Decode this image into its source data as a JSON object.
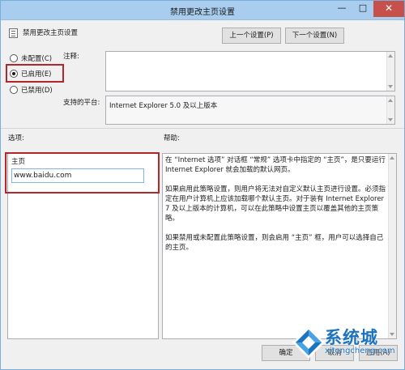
{
  "window": {
    "title": "禁用更改主页设置",
    "minimize_glyph": "—",
    "maximize_glyph": "□",
    "close_glyph": "✕"
  },
  "header": {
    "policy_name": "禁用更改主页设置",
    "prev_button": "上一个设置(P)",
    "next_button": "下一个设置(N)"
  },
  "state": {
    "options": [
      {
        "label": "未配置(C)",
        "checked": false
      },
      {
        "label": "已启用(E)",
        "checked": true
      },
      {
        "label": "已禁用(D)",
        "checked": false
      }
    ]
  },
  "comment": {
    "label": "注释:",
    "value": ""
  },
  "platform": {
    "label": "支持的平台:",
    "value": "Internet Explorer 5.0 及以上版本"
  },
  "options_section": {
    "label": "选项:",
    "homepage_label": "主页",
    "homepage_value": "www.baidu.com"
  },
  "help_section": {
    "label": "帮助:",
    "paragraphs": [
      "在 “Internet 选项” 对话框 “常规” 选项卡中指定的 “主页”，是只要运行 Internet Explorer 就会加载的默认网页。",
      "如果启用此策略设置，则用户将无法对自定义默认主页进行设置。必须指定在用户计算机上应该加载哪个默认主页。对于装有 Internet Explorer 7 及以上版本的计算机，可以在此策略中设置主页以覆盖其他的主页策略。",
      "如果禁用或未配置此策略设置，则会启用 “主页” 框，用户可以选择自己的主页。"
    ]
  },
  "footer": {
    "ok_button": "确定",
    "cancel_button": "取消",
    "apply_button": "应用(A)"
  },
  "watermark": {
    "brand": "系统城",
    "url": "xitongcheng.com"
  },
  "colors": {
    "titlebar": "#a9cdef",
    "close_button": "#c7504d",
    "highlight": "#b3262b",
    "input_focus": "#7eb4ea",
    "watermark_blue": "#1c73bf"
  }
}
